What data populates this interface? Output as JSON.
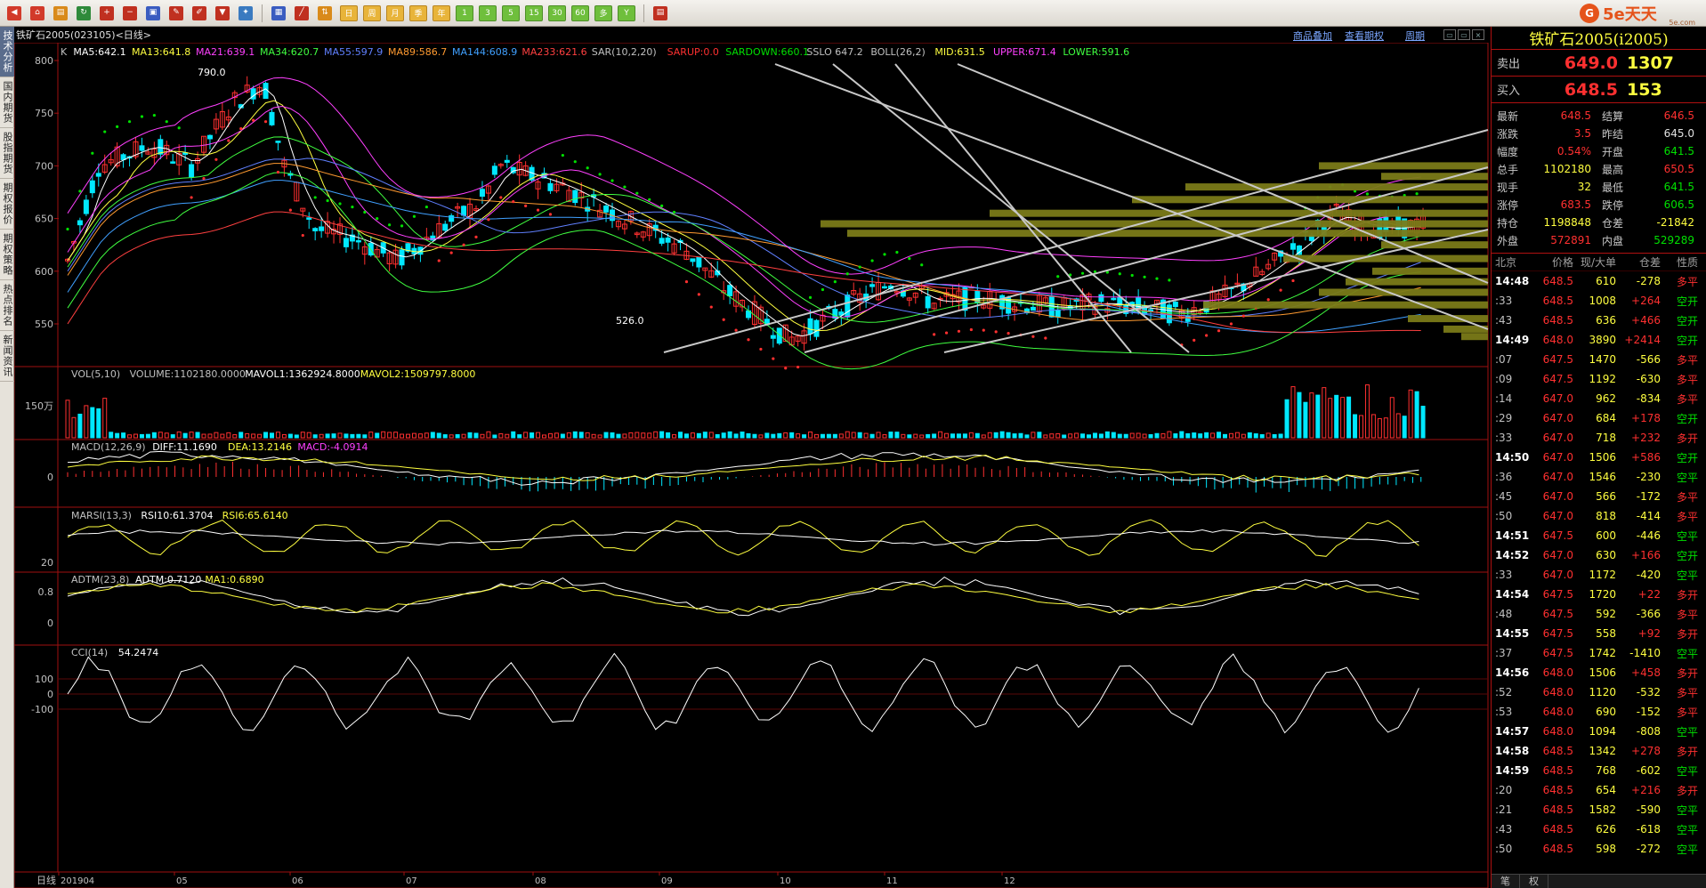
{
  "toolbar": {
    "buttons": [
      {
        "name": "back-icon",
        "glyph": "◀",
        "color": "#d23a2a"
      },
      {
        "name": "home-icon",
        "glyph": "⌂",
        "color": "#d23a2a"
      },
      {
        "name": "notebook-icon",
        "glyph": "▤",
        "color": "#d98a1a"
      },
      {
        "name": "refresh-icon",
        "glyph": "↻",
        "color": "#2e8a3a"
      },
      {
        "name": "zoom-in-icon",
        "glyph": "+",
        "color": "#c03020"
      },
      {
        "name": "zoom-out-icon",
        "glyph": "−",
        "color": "#c03020"
      },
      {
        "name": "window-icon",
        "glyph": "▣",
        "color": "#3a5cc0"
      },
      {
        "name": "draw-pen-icon",
        "glyph": "✎",
        "color": "#c03020"
      },
      {
        "name": "brush-icon",
        "glyph": "✐",
        "color": "#c03020"
      },
      {
        "name": "filter-icon",
        "glyph": "▼",
        "color": "#c03020"
      },
      {
        "name": "new-icon",
        "glyph": "✦",
        "color": "#3a7ac0"
      }
    ],
    "tools": [
      {
        "name": "table-icon",
        "glyph": "▦",
        "color": "#3a5cc0"
      },
      {
        "name": "line-chart-icon",
        "glyph": "╱",
        "color": "#c03020"
      },
      {
        "name": "compare-icon",
        "glyph": "⇅",
        "color": "#d98a1a"
      }
    ],
    "periods": [
      "日",
      "周",
      "月",
      "季",
      "年",
      "1",
      "3",
      "5",
      "15",
      "30",
      "60",
      "多",
      "Y"
    ],
    "period_styles": [
      "yel",
      "yel",
      "yel",
      "yel",
      "yel",
      "",
      "",
      "",
      "",
      "",
      "",
      "",
      ""
    ],
    "calc_icon": "▤"
  },
  "logo": {
    "text": "5e天天",
    "url": "5e.com"
  },
  "left_tabs": [
    "技术分析",
    "国内期货",
    "股指期货",
    "期权报价",
    "期权策略",
    "热点排名",
    "新闻资讯"
  ],
  "chart": {
    "title": "铁矿石2005(023105)<日线>",
    "links": [
      "商品叠加",
      "查看期权",
      "周期"
    ],
    "main_legend": [
      {
        "t": "K",
        "c": "#c0c0c0"
      },
      {
        "t": "MA5:642.1",
        "c": "#ffffff"
      },
      {
        "t": "MA13:641.8",
        "c": "#ffff40"
      },
      {
        "t": "MA21:639.1",
        "c": "#ff40ff"
      },
      {
        "t": "MA34:620.7",
        "c": "#40ff40"
      },
      {
        "t": "MA55:597.9",
        "c": "#6080ff"
      },
      {
        "t": "MA89:586.7",
        "c": "#ff9a30"
      },
      {
        "t": "MA144:608.9",
        "c": "#40a0ff"
      },
      {
        "t": "MA233:621.6",
        "c": "#ff4040"
      },
      {
        "t": "SAR(10,2,20)",
        "c": "#c0c0c0"
      },
      {
        "t": "SARUP:0.0",
        "c": "#ff3030"
      },
      {
        "t": "SARDOWN:660.1",
        "c": "#00e000"
      },
      {
        "t": "SSLO 647.2",
        "c": "#c0c0c0"
      },
      {
        "t": "BOLL(26,2)",
        "c": "#c0c0c0"
      },
      {
        "t": "MID:631.5",
        "c": "#ffff40"
      },
      {
        "t": "UPPER:671.4",
        "c": "#ff40ff"
      },
      {
        "t": "LOWER:591.6",
        "c": "#40ff40"
      }
    ],
    "price_ticks": [
      "800",
      "750",
      "700",
      "650",
      "600",
      "550"
    ],
    "high_label": "790.0",
    "low_label": "526.0",
    "vol_legend": [
      {
        "t": "VOL(5,10)",
        "c": "#c0c0c0"
      },
      {
        "t": "VOLUME:1102180.0000",
        "c": "#c0c0c0"
      },
      {
        "t": "MAVOL1:1362924.8000",
        "c": "#ffffff"
      },
      {
        "t": "MAVOL2:1509797.8000",
        "c": "#ffff40"
      }
    ],
    "vol_tick": "150万",
    "macd_legend": [
      {
        "t": "MACD(12,26,9)",
        "c": "#c0c0c0"
      },
      {
        "t": "DIFF:11.1690",
        "c": "#ffffff"
      },
      {
        "t": "DEA:13.2146",
        "c": "#ffff40"
      },
      {
        "t": "MACD:-4.0914",
        "c": "#ff40ff"
      }
    ],
    "macd_tick": "0",
    "marsi_legend": [
      {
        "t": "MARSI(13,3)",
        "c": "#c0c0c0"
      },
      {
        "t": "RSI10:61.3704",
        "c": "#ffffff"
      },
      {
        "t": "RSI6:65.6140",
        "c": "#ffff40"
      }
    ],
    "marsi_tick": "20",
    "adtm_legend": [
      {
        "t": "ADTM(23,8)",
        "c": "#c0c0c0"
      },
      {
        "t": "ADTM:0.7120",
        "c": "#ffffff"
      },
      {
        "t": "MA1:0.6890",
        "c": "#ffff40"
      }
    ],
    "adtm_ticks": [
      "0.8",
      "0"
    ],
    "cci_legend": [
      {
        "t": "CCI(14)",
        "c": "#c0c0c0"
      },
      {
        "t": "54.2474",
        "c": "#ffffff"
      }
    ],
    "cci_ticks": [
      "100",
      "0",
      "-100"
    ],
    "x_corner": "日线",
    "x_labels": [
      "201904",
      "05",
      "06",
      "07",
      "08",
      "09",
      "10",
      "11",
      "12"
    ]
  },
  "quote": {
    "title": "铁矿石2005(i2005)",
    "sell_label": "卖出",
    "sell_price": "649.0",
    "sell_vol": "1307",
    "buy_label": "买入",
    "buy_price": "648.5",
    "buy_vol": "153",
    "stats": [
      {
        "l": "最新",
        "v": "648.5",
        "vc": "red",
        "l2": "结算",
        "v2": "646.5",
        "v2c": "red"
      },
      {
        "l": "涨跌",
        "v": "3.5",
        "vc": "red",
        "l2": "昨结",
        "v2": "645.0",
        "v2c": "white"
      },
      {
        "l": "幅度",
        "v": "0.54%",
        "vc": "red",
        "l2": "开盘",
        "v2": "641.5",
        "v2c": "green"
      },
      {
        "l": "总手",
        "v": "1102180",
        "vc": "yellow",
        "l2": "最高",
        "v2": "650.5",
        "v2c": "red"
      },
      {
        "l": "现手",
        "v": "32",
        "vc": "yellow",
        "l2": "最低",
        "v2": "641.5",
        "v2c": "green"
      },
      {
        "l": "涨停",
        "v": "683.5",
        "vc": "red",
        "l2": "跌停",
        "v2": "606.5",
        "v2c": "green"
      },
      {
        "l": "持仓",
        "v": "1198848",
        "vc": "yellow",
        "l2": "仓差",
        "v2": "-21842",
        "v2c": "yellow"
      },
      {
        "l": "外盘",
        "v": "572891",
        "vc": "red",
        "l2": "内盘",
        "v2": "529289",
        "v2c": "green"
      }
    ],
    "tick_header": [
      "北京",
      "价格",
      "现/大单",
      "仓差",
      "性质"
    ],
    "ticks": [
      {
        "time": "14:48",
        "price": "648.5",
        "vol": "610",
        "oi": "-278",
        "nat": "多平",
        "nc": "red",
        "bold": true
      },
      {
        "time": ":33",
        "price": "648.5",
        "vol": "1008",
        "oi": "+264",
        "nat": "空开",
        "nc": "green",
        "bold": false
      },
      {
        "time": ":43",
        "price": "648.5",
        "vol": "636",
        "oi": "+466",
        "nat": "空开",
        "nc": "green",
        "bold": false
      },
      {
        "time": "14:49",
        "price": "648.0",
        "vol": "3890",
        "oi": "+2414",
        "nat": "空开",
        "nc": "green",
        "bold": true
      },
      {
        "time": ":07",
        "price": "647.5",
        "vol": "1470",
        "oi": "-566",
        "nat": "多平",
        "nc": "red",
        "bold": false
      },
      {
        "time": ":09",
        "price": "647.5",
        "vol": "1192",
        "oi": "-630",
        "nat": "多平",
        "nc": "red",
        "bold": false
      },
      {
        "time": ":14",
        "price": "647.0",
        "vol": "962",
        "oi": "-834",
        "nat": "多平",
        "nc": "red",
        "bold": false
      },
      {
        "time": ":29",
        "price": "647.0",
        "vol": "684",
        "oi": "+178",
        "nat": "空开",
        "nc": "green",
        "bold": false
      },
      {
        "time": ":33",
        "price": "647.0",
        "vol": "718",
        "oi": "+232",
        "nat": "多开",
        "nc": "red",
        "bold": false
      },
      {
        "time": "14:50",
        "price": "647.0",
        "vol": "1506",
        "oi": "+586",
        "nat": "空开",
        "nc": "green",
        "bold": true
      },
      {
        "time": ":36",
        "price": "647.0",
        "vol": "1546",
        "oi": "-230",
        "nat": "空平",
        "nc": "green",
        "bold": false
      },
      {
        "time": ":45",
        "price": "647.0",
        "vol": "566",
        "oi": "-172",
        "nat": "多平",
        "nc": "red",
        "bold": false
      },
      {
        "time": ":50",
        "price": "647.0",
        "vol": "818",
        "oi": "-414",
        "nat": "多平",
        "nc": "red",
        "bold": false
      },
      {
        "time": "14:51",
        "price": "647.5",
        "vol": "600",
        "oi": "-446",
        "nat": "空平",
        "nc": "green",
        "bold": true
      },
      {
        "time": "14:52",
        "price": "647.0",
        "vol": "630",
        "oi": "+166",
        "nat": "空开",
        "nc": "green",
        "bold": true
      },
      {
        "time": ":33",
        "price": "647.0",
        "vol": "1172",
        "oi": "-420",
        "nat": "空平",
        "nc": "green",
        "bold": false
      },
      {
        "time": "14:54",
        "price": "647.5",
        "vol": "1720",
        "oi": "+22",
        "nat": "多开",
        "nc": "red",
        "bold": true
      },
      {
        "time": ":48",
        "price": "647.5",
        "vol": "592",
        "oi": "-366",
        "nat": "多平",
        "nc": "red",
        "bold": false
      },
      {
        "time": "14:55",
        "price": "647.5",
        "vol": "558",
        "oi": "+92",
        "nat": "多开",
        "nc": "red",
        "bold": true
      },
      {
        "time": ":37",
        "price": "647.5",
        "vol": "1742",
        "oi": "-1410",
        "nat": "空平",
        "nc": "green",
        "bold": false
      },
      {
        "time": "14:56",
        "price": "648.0",
        "vol": "1506",
        "oi": "+458",
        "nat": "多开",
        "nc": "red",
        "bold": true
      },
      {
        "time": ":52",
        "price": "648.0",
        "vol": "1120",
        "oi": "-532",
        "nat": "多平",
        "nc": "red",
        "bold": false
      },
      {
        "time": ":53",
        "price": "648.0",
        "vol": "690",
        "oi": "-152",
        "nat": "多平",
        "nc": "red",
        "bold": false
      },
      {
        "time": "14:57",
        "price": "648.0",
        "vol": "1094",
        "oi": "-808",
        "nat": "空平",
        "nc": "green",
        "bold": true
      },
      {
        "time": "14:58",
        "price": "648.5",
        "vol": "1342",
        "oi": "+278",
        "nat": "多开",
        "nc": "red",
        "bold": true
      },
      {
        "time": "14:59",
        "price": "648.5",
        "vol": "768",
        "oi": "-602",
        "nat": "空平",
        "nc": "green",
        "bold": true
      },
      {
        "time": ":20",
        "price": "648.5",
        "vol": "654",
        "oi": "+216",
        "nat": "多开",
        "nc": "red",
        "bold": false
      },
      {
        "time": ":21",
        "price": "648.5",
        "vol": "1582",
        "oi": "-590",
        "nat": "空平",
        "nc": "green",
        "bold": false
      },
      {
        "time": ":43",
        "price": "648.5",
        "vol": "626",
        "oi": "-618",
        "nat": "空平",
        "nc": "green",
        "bold": false
      },
      {
        "time": ":50",
        "price": "648.5",
        "vol": "598",
        "oi": "-272",
        "nat": "空平",
        "nc": "green",
        "bold": false
      }
    ],
    "bottom_tabs": [
      "笔",
      "权"
    ]
  }
}
